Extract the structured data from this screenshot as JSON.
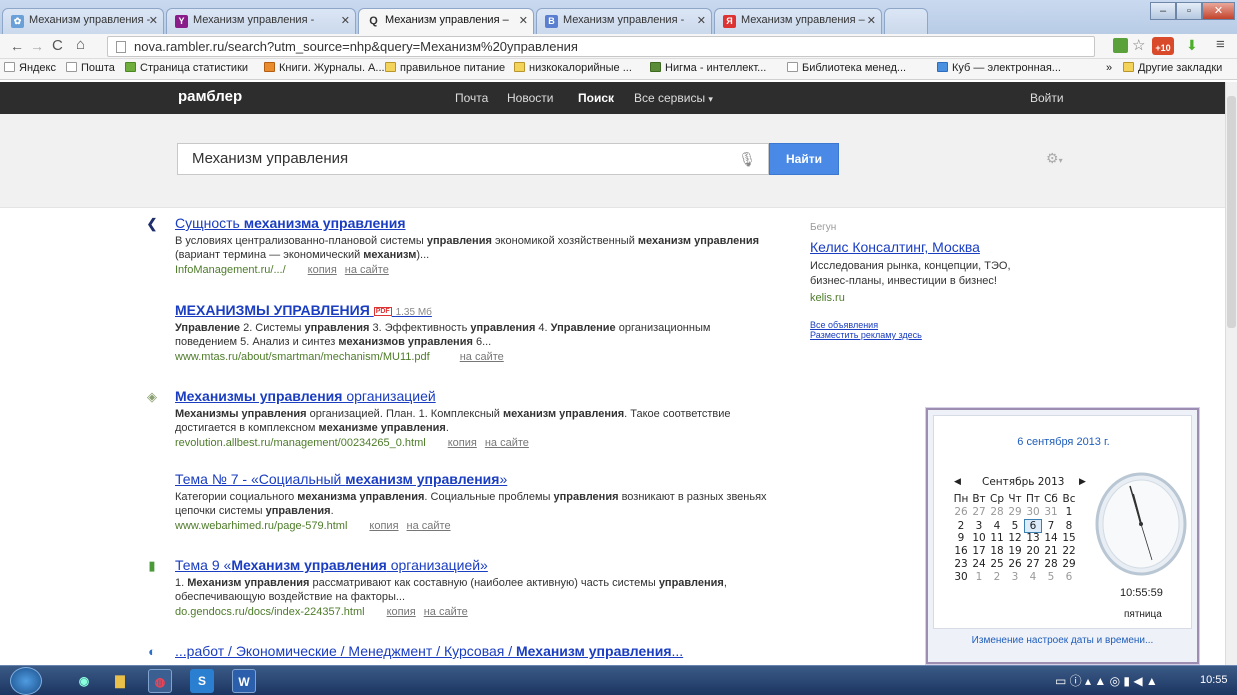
{
  "browser": {
    "tabs": [
      {
        "label": "Механизм управления -",
        "icon": "rambler-icon",
        "color": "#6aa0d8"
      },
      {
        "label": "Механизм управления -",
        "icon": "yandex-icon",
        "color": "#8a1d8a"
      },
      {
        "label": "Механизм управления –",
        "icon": "search-icon",
        "color": "#ffffff"
      },
      {
        "label": "Механизм управления -",
        "icon": "b-icon",
        "color": "#5a7fd0"
      },
      {
        "label": "Механизм управления –",
        "icon": "ya-icon",
        "color": "#d33"
      }
    ],
    "url": "nova.rambler.ru/search?utm_source=nhp&query=Механизм%20управления",
    "extension_badge": "+10",
    "bookmarks": [
      "Яндекс",
      "Пошта",
      "Страница статистики",
      "Книги. Журналы. А...",
      "правильное питание",
      "низкокалорийные ...",
      "Нигма - интеллект...",
      "Библиотека менед...",
      "Куб — электронная..."
    ],
    "bookmarks_more": "»",
    "other_bookmarks": "Другие закладки"
  },
  "header": {
    "logo": "рамблер",
    "nav": [
      "Почта",
      "Новости",
      "Поиск",
      "Все сервисы"
    ],
    "login": "Войти"
  },
  "search": {
    "query": "Механизм управления",
    "button": "Найти"
  },
  "results": [
    {
      "title_parts": [
        [
          "Сущность ",
          false
        ],
        [
          "механизма управления",
          true
        ]
      ],
      "snippet": [
        [
          "В условиях централизованно-плановой системы ",
          false
        ],
        [
          "управления",
          true
        ],
        [
          " экономикой хозяйственный ",
          false
        ],
        [
          "механизм",
          true
        ],
        [
          " ",
          false
        ],
        [
          "управления",
          true
        ],
        [
          " (вариант термина — экономический ",
          false
        ],
        [
          "механизм",
          true
        ],
        [
          ")...",
          false
        ]
      ],
      "url": "InfoManagement.ru/.../",
      "links": [
        "копия",
        "на сайте"
      ]
    },
    {
      "title_parts": [
        [
          "МЕХАНИЗМЫ УПРАВЛЕНИЯ",
          true
        ]
      ],
      "pdf": "PDF",
      "size": "1.35 Мб",
      "snippet": [
        [
          "Управление",
          true
        ],
        [
          " 2. Системы ",
          false
        ],
        [
          "управления",
          true
        ],
        [
          " 3. Эффективность ",
          false
        ],
        [
          "управления",
          true
        ],
        [
          " 4. ",
          false
        ],
        [
          "Управление",
          true
        ],
        [
          " организационным поведением 5. Анализ и синтез ",
          false
        ],
        [
          "механизмов управления",
          true
        ],
        [
          " 6...",
          false
        ]
      ],
      "url": "www.mtas.ru/about/smartman/mechanism/MU11.pdf",
      "links": [
        "на сайте"
      ]
    },
    {
      "title_parts": [
        [
          "Механизмы управления",
          true
        ],
        [
          " организацией",
          false
        ]
      ],
      "snippet": [
        [
          "Механизмы управления",
          true
        ],
        [
          " организацией. План. 1. Комплексный ",
          false
        ],
        [
          "механизм управления",
          true
        ],
        [
          ". Такое соответствие достигается в комплексном ",
          false
        ],
        [
          "механизме управления",
          true
        ],
        [
          ".",
          false
        ]
      ],
      "url": "revolution.allbest.ru/management/00234265_0.html",
      "links": [
        "копия",
        "на сайте"
      ]
    },
    {
      "title_parts": [
        [
          "Тема № 7 - «Социальный ",
          false
        ],
        [
          "механизм управления",
          true
        ],
        [
          "»",
          false
        ]
      ],
      "snippet": [
        [
          "Категории социального ",
          false
        ],
        [
          "механизма управления",
          true
        ],
        [
          ". Социальные проблемы ",
          false
        ],
        [
          "управления",
          true
        ],
        [
          " возникают в разных звеньях цепочки системы ",
          false
        ],
        [
          "управления",
          true
        ],
        [
          ".",
          false
        ]
      ],
      "url": "www.webarhimed.ru/page-579.html",
      "links": [
        "копия",
        "на сайте"
      ]
    },
    {
      "title_parts": [
        [
          "Тема 9 «",
          false
        ],
        [
          "Механизм управления",
          true
        ],
        [
          " организацией»",
          false
        ]
      ],
      "snippet": [
        [
          "1. ",
          false
        ],
        [
          "Механизм управления",
          true
        ],
        [
          " рассматривают как составную (наиболее активную) часть системы ",
          false
        ],
        [
          "управления",
          true
        ],
        [
          ", обеспечивающую воздействие на факторы...",
          false
        ]
      ],
      "url": "do.gendocs.ru/docs/index-224357.html",
      "links": [
        "копия",
        "на сайте"
      ]
    },
    {
      "title_parts": [
        [
          "...работ / Экономические / Менеджмент / Курсовая / ",
          false
        ],
        [
          "Механизм управления",
          true
        ],
        [
          "...",
          false
        ]
      ],
      "snippet": [],
      "url": "",
      "links": []
    }
  ],
  "ads": {
    "label": "Бегун",
    "title": "Келис Консалтинг, Москва",
    "text": "Исследования рынка, концепции, ТЭО, бизнес-планы, инвестиции в бизнес!",
    "domain": "kelis.ru",
    "all": "Все объявления",
    "place": "Разместить рекламу здесь"
  },
  "calendar": {
    "date_header": "6 сентября 2013 г.",
    "month": "Сентябрь 2013",
    "weekdays": [
      "Пн",
      "Вт",
      "Ср",
      "Чт",
      "Пт",
      "Сб",
      "Вс"
    ],
    "weeks": [
      [
        "26",
        "27",
        "28",
        "29",
        "30",
        "31",
        "1"
      ],
      [
        "2",
        "3",
        "4",
        "5",
        "6",
        "7",
        "8"
      ],
      [
        "9",
        "10",
        "11",
        "12",
        "13",
        "14",
        "15"
      ],
      [
        "16",
        "17",
        "18",
        "19",
        "20",
        "21",
        "22"
      ],
      [
        "23",
        "24",
        "25",
        "26",
        "27",
        "28",
        "29"
      ],
      [
        "30",
        "1",
        "2",
        "3",
        "4",
        "5",
        "6"
      ]
    ],
    "time": "10:55:59",
    "weekday_name": "пятница",
    "change_link": "Изменение настроек даты и времени..."
  },
  "taskbar": {
    "clock": "10:55"
  },
  "colors": {
    "link": "#1a3dc1",
    "url_green": "#4e7c2a",
    "find_button": "#4a8ae6",
    "header_bg": "#2d2d2d"
  }
}
